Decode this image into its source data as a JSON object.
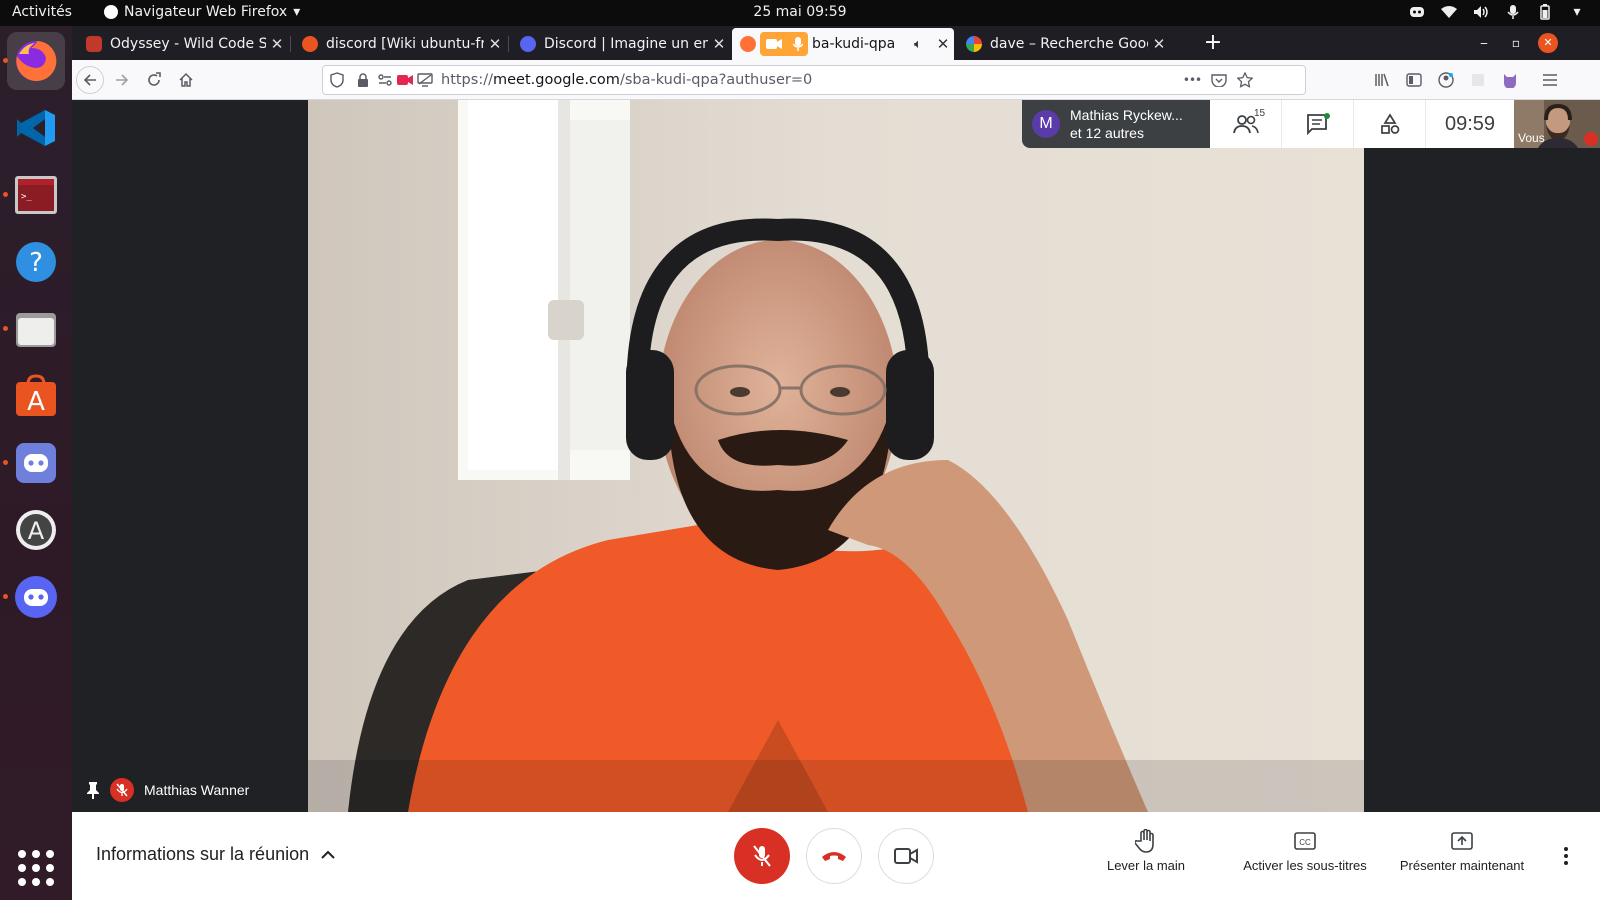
{
  "topbar": {
    "activities": "Activités",
    "app_menu": "Navigateur Web Firefox",
    "clock": "25 mai  09:59"
  },
  "dock": {
    "items": [
      "Firefox",
      "Visual Studio Code",
      "Terminal",
      "Help",
      "Files",
      "Ubuntu Software",
      "Discord",
      "Software Updater",
      "Discord"
    ]
  },
  "tabs": [
    {
      "title": "Odyssey - Wild Code School",
      "favicon_color": "#c0392b"
    },
    {
      "title": "discord [Wiki ubuntu-fr]",
      "favicon_color": "#e95420"
    },
    {
      "title": "Discord | Imagine un endroit",
      "favicon_color": "#5865f2"
    },
    {
      "title": "ba-kudi-qpa",
      "favicon_color": "#ff7139",
      "selected": true
    },
    {
      "title": "dave – Recherche Google",
      "favicon_color": "#4285f4"
    }
  ],
  "navbar": {
    "url_host": "meet.google.com",
    "url_prefix": "https://",
    "url_path": "/sba-kudi-qpa?authuser=0",
    "overflow": "•••"
  },
  "meet": {
    "presenter_name": "Matthias Wanner",
    "participants_chip": {
      "initial": "M",
      "line1": "Mathias Ryckew...",
      "line2": "et 12 autres"
    },
    "participant_count": "15",
    "time": "09:59",
    "self_label": "Vous"
  },
  "bottombar": {
    "meeting_info": "Informations sur la réunion",
    "raise_hand": "Lever la main",
    "captions": "Activer les sous-titres",
    "present": "Présenter maintenant"
  },
  "colors": {
    "meet_red": "#d93025",
    "firefox_dark": "#1f1e25",
    "dock_bg": "#2e1a27",
    "shirt": "#f05a28"
  }
}
